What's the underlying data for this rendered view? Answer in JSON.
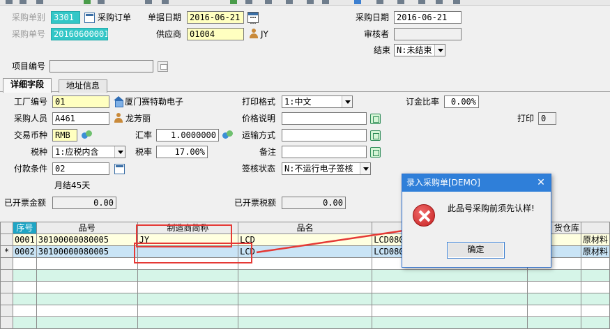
{
  "header": {
    "po_type_label": "采购单别",
    "po_type_value": "3301",
    "po_type_name": "采购订单",
    "po_no_label": "采购单号",
    "po_no_value": "20160600001",
    "doc_date_label": "单据日期",
    "doc_date_value": "2016-06-21",
    "supplier_label": "供应商",
    "supplier_value": "01004",
    "supplier_name": "JY",
    "purchase_date_label": "采购日期",
    "purchase_date_value": "2016-06-21",
    "reviewer_label": "审核者",
    "reviewer_value": "",
    "closed_label": "结束",
    "closed_value": "N:未结束",
    "project_label": "项目编号",
    "project_value": ""
  },
  "tabs": [
    {
      "label": "详细字段",
      "active": true
    },
    {
      "label": "地址信息",
      "active": false
    }
  ],
  "detail": {
    "factory_label": "工厂编号",
    "factory_value": "01",
    "factory_name": "厦门赛特勒电子",
    "buyer_label": "采购人员",
    "buyer_value": "A461",
    "buyer_name": "龙芳丽",
    "currency_label": "交易币种",
    "currency_value": "RMB",
    "rate_label": "汇率",
    "rate_value": "1.0000000",
    "tax_type_label": "税种",
    "tax_type_value": "1:应税内含",
    "tax_rate_label": "税率",
    "tax_rate_value": "17.00%",
    "payment_label": "付款条件",
    "payment_value": "02",
    "payment_desc": "月结45天",
    "print_format_label": "打印格式",
    "print_format_value": "1:中文",
    "price_note_label": "价格说明",
    "price_note_value": "",
    "shipping_label": "运输方式",
    "shipping_value": "",
    "remark_label": "备注",
    "remark_value": "",
    "sign_status_label": "签核状态",
    "sign_status_value": "N:不运行电子签核",
    "deposit_label": "订金比率",
    "deposit_value": "0.00%",
    "print_label": "打印",
    "print_value": "0",
    "invoiced_amount_label": "已开票金额",
    "invoiced_amount_value": "0.00",
    "invoiced_tax_label": "已开票税额",
    "invoiced_tax_value": "0.00"
  },
  "grid": {
    "columns": [
      "序号",
      "品号",
      "制造商简称",
      "品名",
      "",
      "交货仓库",
      ""
    ],
    "col_partial": {
      "c5": "LCD08",
      "c6": "货仓库"
    },
    "rows": [
      {
        "indicator": "",
        "seq": "0001",
        "item_no": "30100000080005",
        "maker": "JY",
        "name": "LCD",
        "spec": "LCD080",
        "warehouse": "原材料"
      },
      {
        "indicator": "*",
        "seq": "0002",
        "item_no": "30100000080005",
        "maker": "",
        "name": "LCD",
        "spec": "LCD080",
        "warehouse": "原材料"
      }
    ]
  },
  "dialog": {
    "title": "录入采购单[DEMO]",
    "close": "✕",
    "message": "此品号采购前须先认样!",
    "ok_label": "确定"
  }
}
